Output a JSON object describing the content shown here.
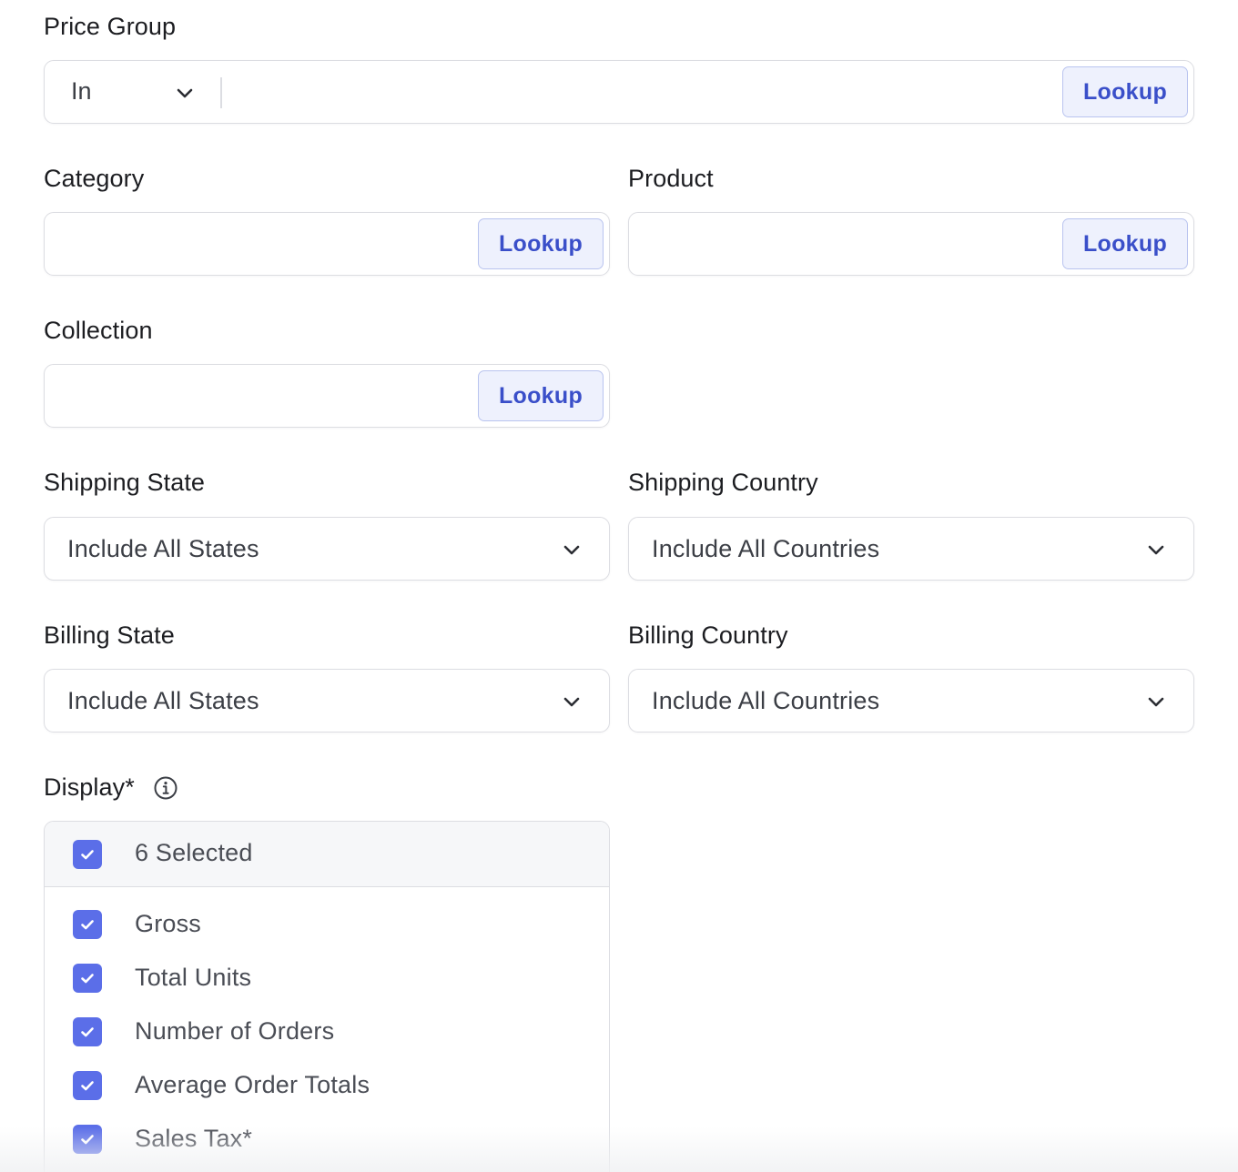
{
  "price_group": {
    "label": "Price Group",
    "operator": "In",
    "value": "",
    "lookup_label": "Lookup"
  },
  "category": {
    "label": "Category",
    "value": "",
    "lookup_label": "Lookup"
  },
  "product": {
    "label": "Product",
    "value": "",
    "lookup_label": "Lookup"
  },
  "collection": {
    "label": "Collection",
    "value": "",
    "lookup_label": "Lookup"
  },
  "shipping_state": {
    "label": "Shipping State",
    "value": "Include All States"
  },
  "shipping_country": {
    "label": "Shipping Country",
    "value": "Include All Countries"
  },
  "billing_state": {
    "label": "Billing State",
    "value": "Include All States"
  },
  "billing_country": {
    "label": "Billing Country",
    "value": "Include All Countries"
  },
  "display": {
    "label": "Display*",
    "info_icon": "info-circle-icon",
    "select_all_label": "6 Selected",
    "options": [
      {
        "label": "Gross",
        "checked": true
      },
      {
        "label": "Total Units",
        "checked": true
      },
      {
        "label": "Number of Orders",
        "checked": true
      },
      {
        "label": "Average Order Totals",
        "checked": true
      },
      {
        "label": "Sales Tax*",
        "checked": true
      }
    ]
  },
  "colors": {
    "accent": "#5b6ee8",
    "lookup_text": "#3a4fc9",
    "lookup_bg": "#eef1fd",
    "border": "#dcdde2"
  }
}
